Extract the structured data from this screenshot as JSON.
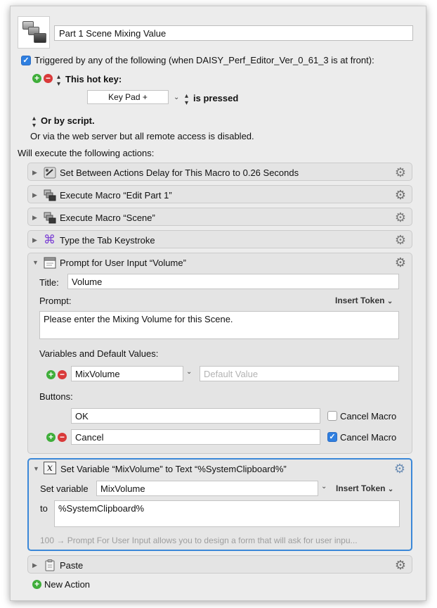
{
  "macro": {
    "name": "Part 1 Scene Mixing Value"
  },
  "trigger": {
    "checked": true,
    "label": "Triggered by any of the following (when DAISY_Perf_Editor_Ver_0_61_3 is at front):",
    "hotkey_label": "This hot key:",
    "hotkey_value": "Key Pad +",
    "hotkey_state": "is pressed",
    "script_label": "Or by script.",
    "web_label": "Or via the web server but all remote access is disabled."
  },
  "actions_header": "Will execute the following actions:",
  "actions": [
    {
      "title": "Set Between Actions Delay for This Macro to 0.26 Seconds"
    },
    {
      "title": "Execute Macro “Edit Part 1”"
    },
    {
      "title": "Execute Macro “Scene”"
    },
    {
      "title": "Type the Tab Keystroke"
    },
    {
      "title": "Prompt for User Input “Volume”",
      "title_label": "Title:",
      "title_value": "Volume",
      "prompt_label": "Prompt:",
      "insert_token": "Insert Token",
      "prompt_value": "Please enter the Mixing Volume for this Scene.",
      "variables_label": "Variables and Default Values:",
      "variable_name": "MixVolume",
      "default_placeholder": "Default Value",
      "buttons_label": "Buttons:",
      "buttons": [
        {
          "label": "OK",
          "cancel_label": "Cancel Macro",
          "cancel_checked": false
        },
        {
          "label": "Cancel",
          "cancel_label": "Cancel Macro",
          "cancel_checked": true
        }
      ]
    },
    {
      "title": "Set Variable “MixVolume” to Text “%SystemClipboard%”",
      "set_label": "Set variable",
      "variable_name": "MixVolume",
      "insert_token": "Insert Token",
      "to_label": "to",
      "to_value": "%SystemClipboard%",
      "hint": "100 → Prompt For User Input allows you to design a form that will ask for user inpu..."
    },
    {
      "title": "Paste"
    }
  ],
  "new_action": "New Action",
  "colors": {
    "accent": "#3b88d8",
    "add": "#3fae3a",
    "remove": "#d93a3a"
  }
}
